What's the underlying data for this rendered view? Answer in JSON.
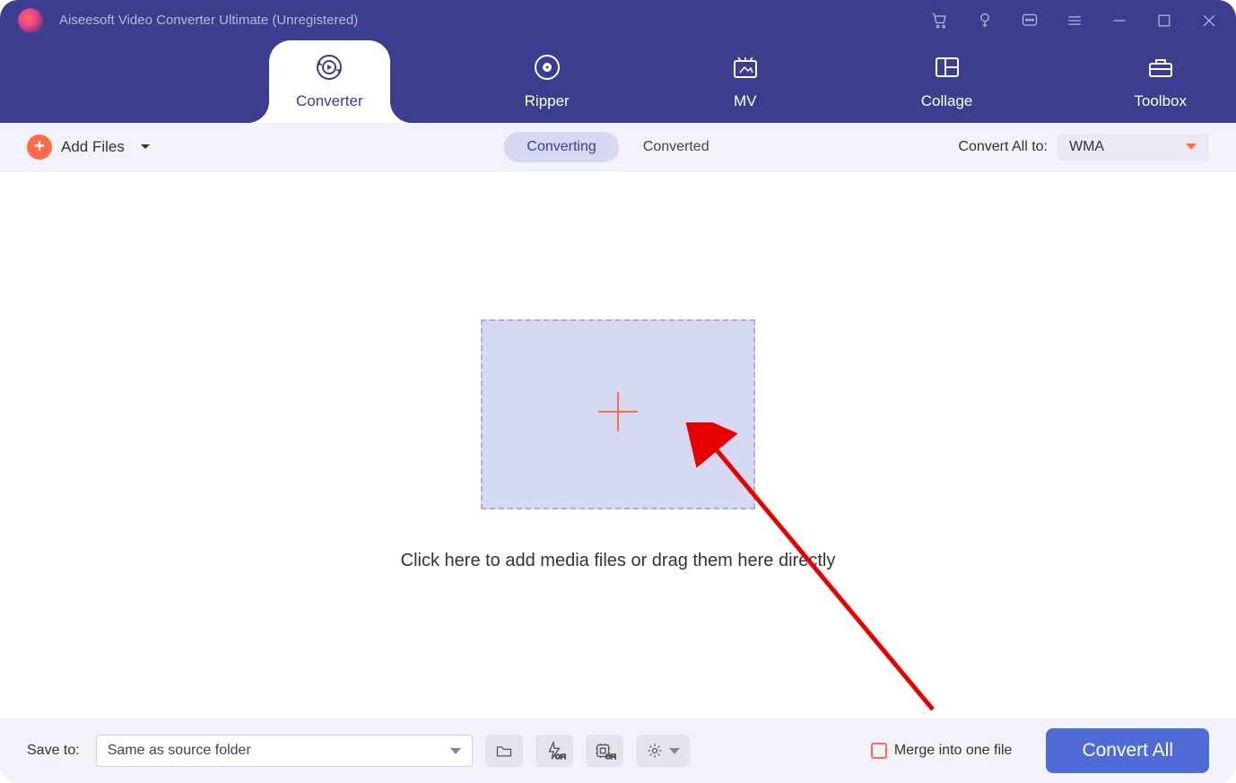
{
  "window": {
    "title": "Aiseesoft Video Converter Ultimate (Unregistered)"
  },
  "tabs": {
    "converter": "Converter",
    "ripper": "Ripper",
    "mv": "MV",
    "collage": "Collage",
    "toolbox": "Toolbox"
  },
  "toolbar": {
    "add_files": "Add Files",
    "converting": "Converting",
    "converted": "Converted",
    "convert_all_to": "Convert All to:",
    "format": "WMA"
  },
  "dropzone": {
    "label": "Click here to add media files or drag them here directly"
  },
  "bottom": {
    "save_to": "Save to:",
    "save_path": "Same as source folder",
    "merge_label": "Merge into one file",
    "convert_all": "Convert All"
  }
}
